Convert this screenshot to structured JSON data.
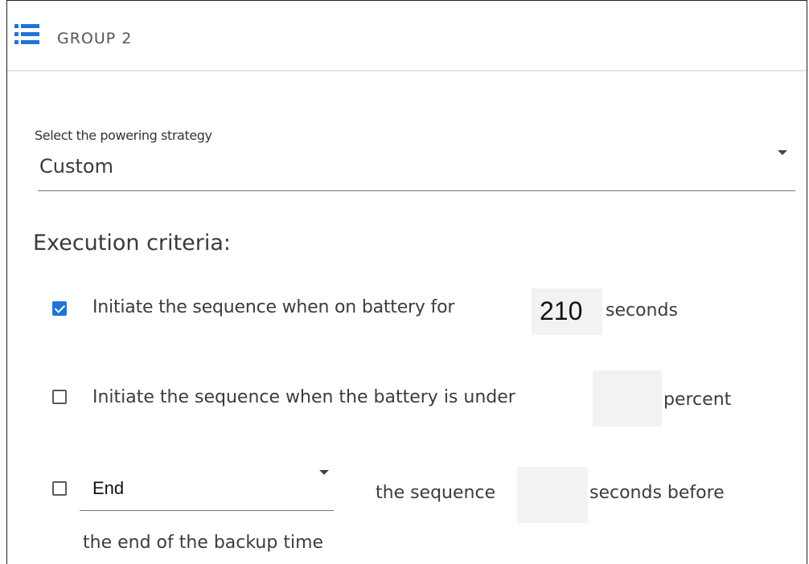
{
  "header": {
    "title": "GROUP 2",
    "menu_icon": "menu-list-icon",
    "accent_color": "#1f73d6"
  },
  "powering": {
    "label": "Select the powering strategy",
    "value": "Custom"
  },
  "criteria": {
    "title": "Execution criteria:",
    "battery_time": {
      "checked": true,
      "text_before": "Initiate  the sequence when on battery for",
      "value": "210",
      "text_after": "seconds"
    },
    "battery_percent": {
      "checked": false,
      "text_before": "Initiate the sequence when the battery is under",
      "value": "",
      "text_after": "percent"
    },
    "backup_time": {
      "checked": false,
      "select_value": "End",
      "text_before": "the sequence",
      "value": "",
      "text_after": "seconds before",
      "text_line2": "the end of the backup time"
    }
  }
}
